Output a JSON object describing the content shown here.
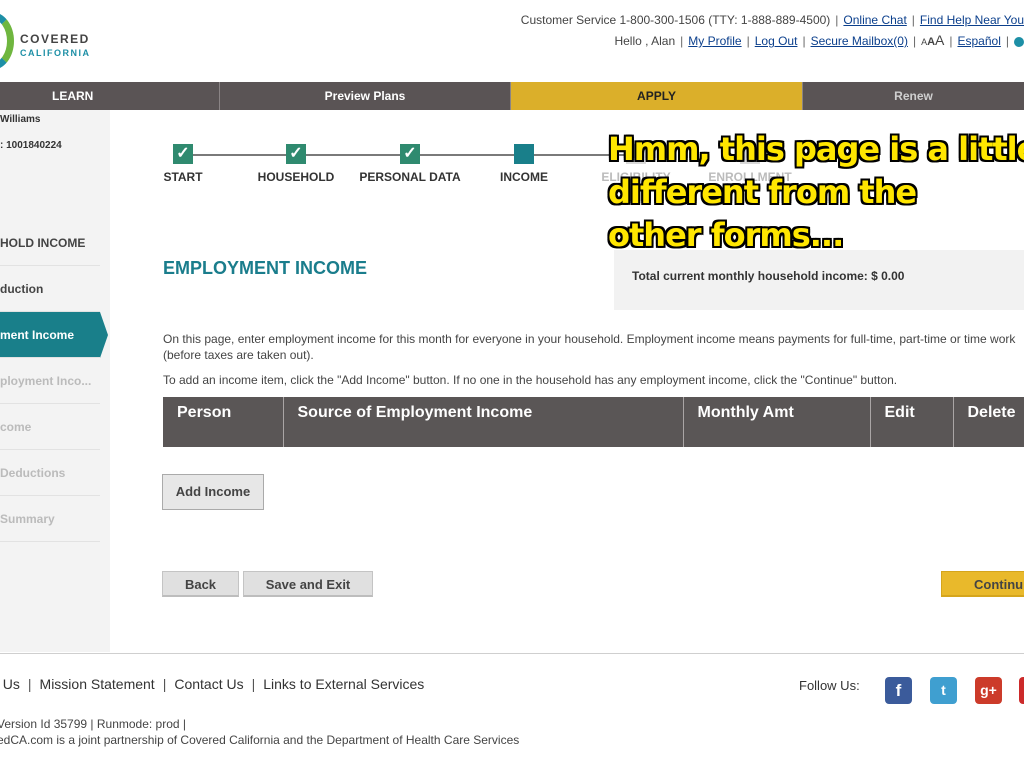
{
  "brand": {
    "line1": "COVERED",
    "line2": "CALIFORNIA"
  },
  "topbar": {
    "customer_service": "Customer Service 1-800-300-1506 (TTY: 1-888-889-4500)",
    "online_chat": "Online Chat",
    "find_help": "Find Help Near You",
    "hello": "Hello , Alan",
    "my_profile": "My Profile",
    "log_out": "Log Out",
    "secure_mailbox": "Secure Mailbox(0)",
    "font_size": [
      "A",
      "A",
      "A"
    ],
    "language": "Español"
  },
  "nav": {
    "learn": "LEARN",
    "preview": "Preview Plans",
    "apply": "APPLY",
    "renew": "Renew",
    "active": "APPLY",
    "active_color": "#dbaf2a"
  },
  "sidebar": {
    "name": "Williams",
    "id_line": ": 1001840224",
    "items": [
      {
        "label": "HOLD INCOME",
        "state": "section"
      },
      {
        "label": "duction",
        "state": "normal"
      },
      {
        "label": "ment Income",
        "state": "active"
      },
      {
        "label": "ployment Inco...",
        "state": "disabled"
      },
      {
        "label": "come",
        "state": "disabled"
      },
      {
        "label": "Deductions",
        "state": "disabled"
      },
      {
        "label": "Summary",
        "state": "disabled"
      }
    ]
  },
  "steps": [
    {
      "label": "START",
      "state": "done",
      "icon": "check-icon"
    },
    {
      "label": "HOUSEHOLD",
      "state": "done",
      "icon": "check-icon"
    },
    {
      "label": "PERSONAL DATA",
      "state": "done",
      "icon": "check-icon"
    },
    {
      "label": "INCOME",
      "state": "current"
    },
    {
      "label": "ELIGIBILITY",
      "state": "pending"
    },
    {
      "label": "ENROLLMENT",
      "state": "pending"
    }
  ],
  "annotation": "Hmm, this page is a little\ndifferent from the\nother forms...",
  "main": {
    "title": "EMPLOYMENT INCOME",
    "total_income": "Total current monthly household income: $ 0.00",
    "intro": "On this page, enter employment income for this month for everyone in your household. Employment income means payments for full-time, part-time or time work (before taxes are taken out).",
    "instructions": "To add an income item, click the \"Add Income\" button. If no one in the household has any employment income, click the \"Continue\" button.",
    "table_headers": [
      "Person",
      "Source of Employment Income",
      "Monthly Amt",
      "Edit",
      "Delete"
    ],
    "add_income": "Add Income",
    "back": "Back",
    "save_exit": "Save and Exit",
    "continue": "Continu"
  },
  "footer": {
    "links": [
      "t Us",
      "Mission Statement",
      "Contact Us",
      "Links to External Services"
    ],
    "follow_us": "Follow Us:",
    "social": [
      {
        "name": "facebook-icon",
        "glyph": "f"
      },
      {
        "name": "twitter-icon",
        "glyph": "t"
      },
      {
        "name": "google-plus-icon",
        "glyph": "g+"
      },
      {
        "name": "youtube-icon",
        "glyph": ""
      }
    ],
    "version": "Version Id 35799  |   Runmode: prod  |",
    "partnership": "edCA.com is a joint partnership of Covered California and the Department of Health Care Services"
  }
}
